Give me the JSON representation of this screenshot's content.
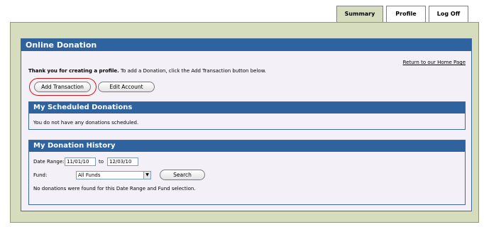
{
  "tabs": {
    "summary": "Summary",
    "profile": "Profile",
    "logoff": "Log Off"
  },
  "panel": {
    "title": "Online Donation",
    "return_link": "Return to our Home Page",
    "welcome_bold": "Thank you for creating a profile.",
    "welcome_rest": " To add a Donation, click the Add Transaction button below.",
    "add_button": "Add Transaction",
    "edit_button": "Edit Account",
    "highlight_color": "#d01818"
  },
  "scheduled": {
    "title": "My Scheduled Donations",
    "message": "You do not have any donations scheduled."
  },
  "history": {
    "title": "My Donation History",
    "date_range_label": "Date Range:",
    "date_from": "11/01/10",
    "date_to_label": "to",
    "date_to": "12/03/10",
    "fund_label": "Fund:",
    "fund_selected": "All Funds",
    "search_button": "Search",
    "no_results": "No donations were found for this Date Range and Fund selection."
  },
  "colors": {
    "header_blue": "#2e63a0",
    "frame_green": "#d6dcbe",
    "panel_bg": "#f3f1f7"
  }
}
